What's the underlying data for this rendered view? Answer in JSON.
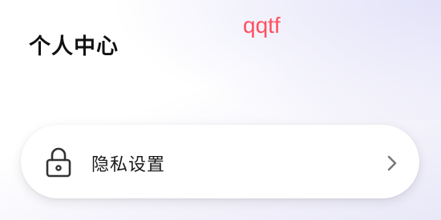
{
  "header": {
    "title": "个人中心",
    "watermark": "qqtf"
  },
  "menu": {
    "items": [
      {
        "label": "隐私设置",
        "icon": "lock-icon",
        "trailing_icon": "chevron-right-icon"
      }
    ]
  },
  "colors": {
    "watermark": "#ff4f5e",
    "title": "#111111",
    "card_background": "#ffffff",
    "page_gradient_tint": "#e9e8f8"
  }
}
